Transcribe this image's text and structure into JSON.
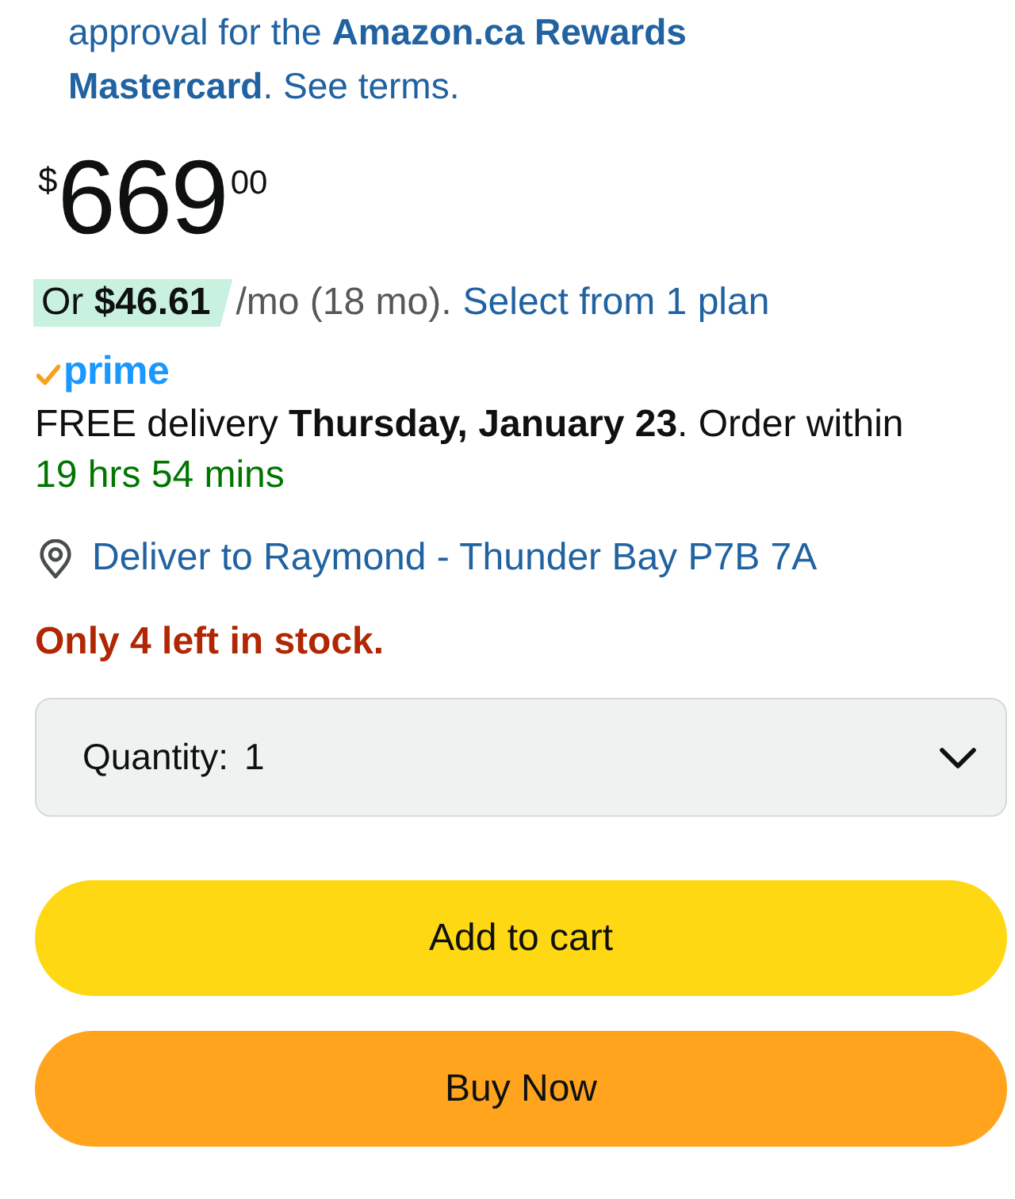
{
  "offer": {
    "text": "approval for the **Amazon.ca Rewards Mastercard**. See terms."
  },
  "price": {
    "currency": "$",
    "whole": "669",
    "fraction": "00"
  },
  "installment": {
    "amount": "Or **$46.61**",
    "term": "/mo (18 mo).",
    "link": "Select from 1 plan"
  },
  "prime": {
    "label": "prime"
  },
  "delivery": {
    "text": "FREE delivery **Thursday, January 23**. Order within",
    "countdown": "19 hrs 54 mins"
  },
  "location": {
    "text": "Deliver to Raymond - Thunder Bay P7B 7A"
  },
  "stock": {
    "text": "Only 4 left in stock."
  },
  "quantity": {
    "label": "Quantity:",
    "value": "1"
  },
  "buttons": [
    {
      "label": "Add to cart",
      "kind": "cart"
    },
    {
      "label": "Buy Now",
      "kind": "buy"
    }
  ]
}
